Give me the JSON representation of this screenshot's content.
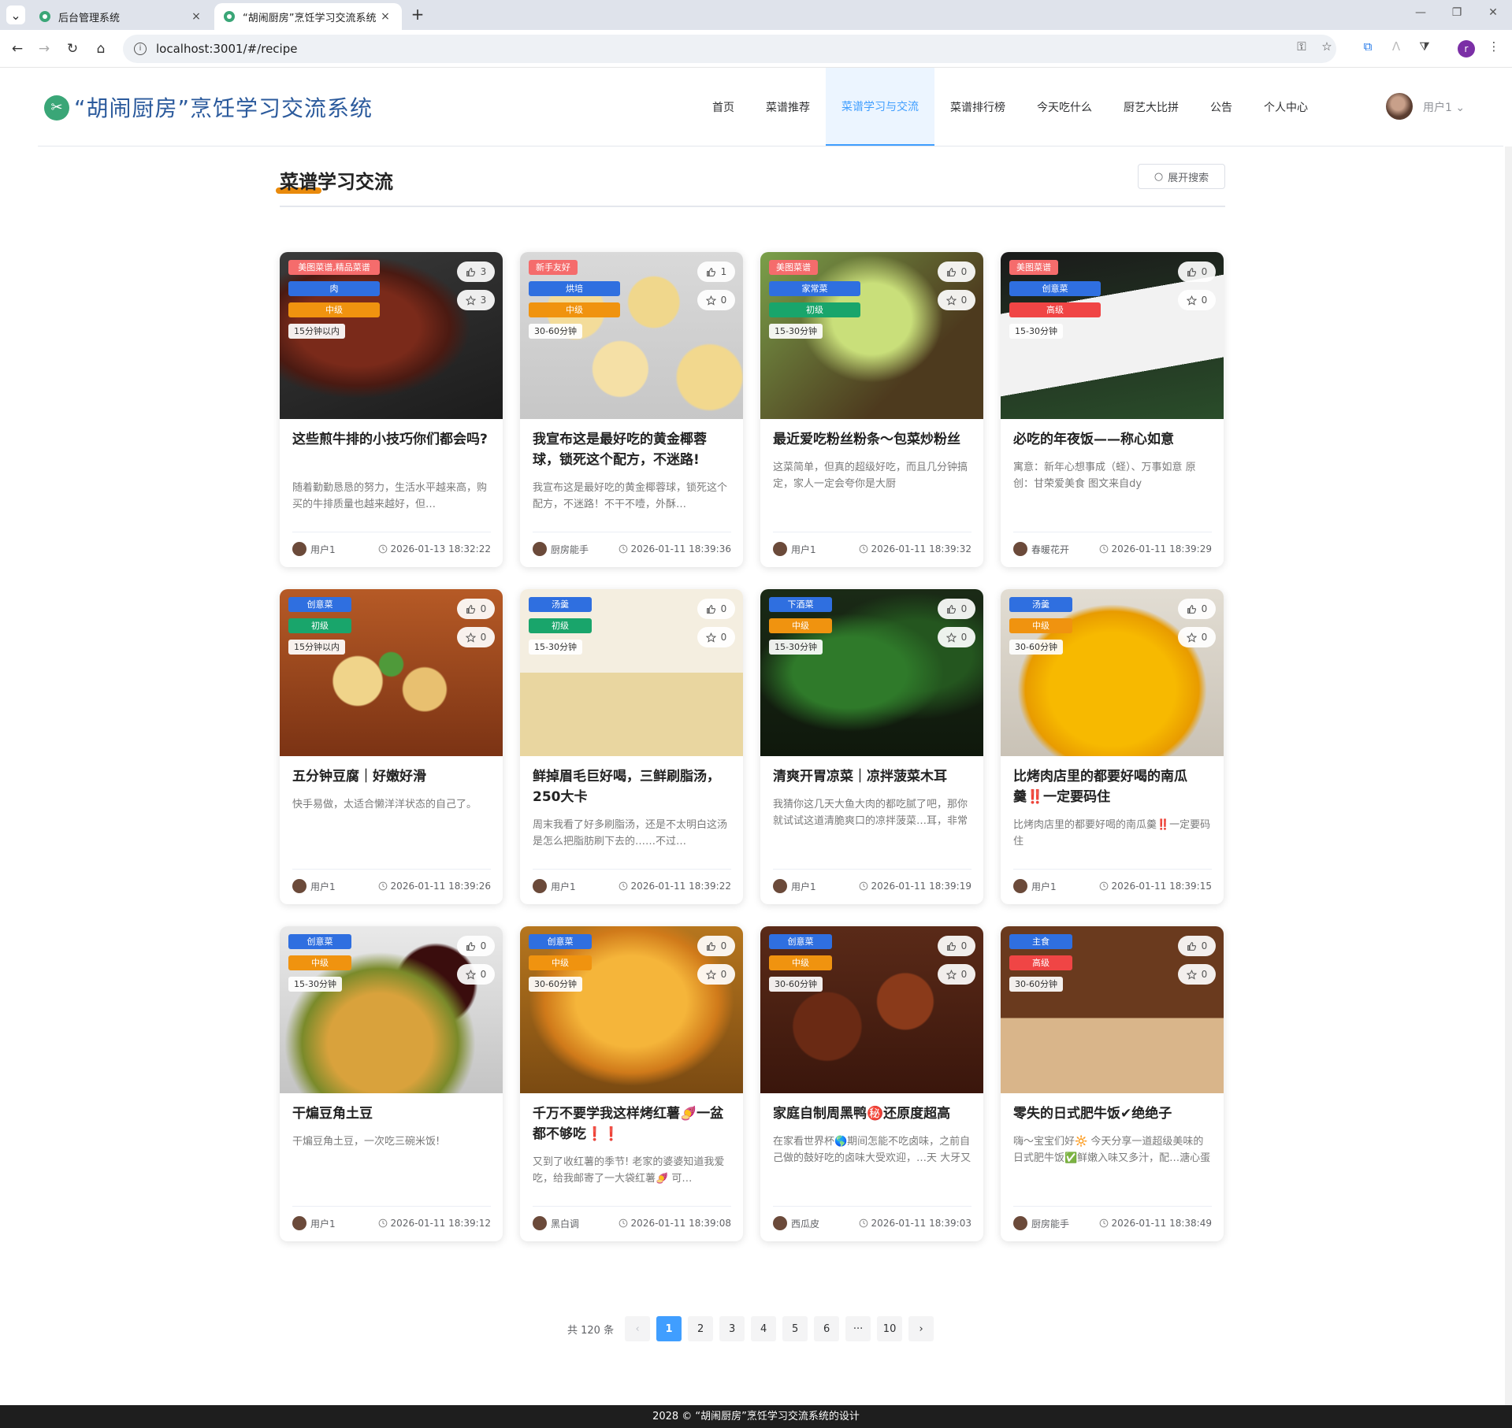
{
  "browser": {
    "tabs": [
      {
        "title": "后台管理系统",
        "close": "×"
      },
      {
        "title": "“胡闹厨房”烹饪学习交流系统",
        "close": "×"
      }
    ],
    "new_tab": "+",
    "url": "localhost:3001/#/recipe",
    "profile_initial": "r",
    "icons": {
      "back": "←",
      "forward": "→",
      "reload": "↻",
      "home": "⌂",
      "key": "⚿",
      "star": "☆",
      "ext": "⧉",
      "puzzle": "⧩",
      "menu": "⋮",
      "minimize": "—",
      "restore": "❐",
      "close": "✕",
      "tab_menu": "⌄"
    }
  },
  "header": {
    "site_title": "“胡闹厨房”烹饪学习交流系统",
    "menu": [
      "首页",
      "菜谱推荐",
      "菜谱学习与交流",
      "菜谱排行榜",
      "今天吃什么",
      "厨艺大比拼",
      "公告",
      "个人中心"
    ],
    "active_menu": 2,
    "user_name": "用户1",
    "user_caret": "⌄"
  },
  "section": {
    "title": "菜谱学习交流",
    "search_button": "展开搜索",
    "search_icon": "○"
  },
  "recipes": [
    {
      "tags": [
        {
          "text": "美图菜谱,精品菜谱",
          "color": "#f56c6c"
        },
        {
          "text": "肉",
          "color": "#2f6fe0"
        },
        {
          "text": "中级",
          "color": "#f0930f"
        },
        {
          "text": "15分钟以内",
          "color": "time"
        }
      ],
      "likes": "3",
      "favs": "3",
      "title": "这些煎牛排的小技巧你们都会吗?",
      "desc": "随着勤勤恳恳的努力，生活水平越来高，购买的牛排质量也越来越好，但…",
      "author": "用户1",
      "date": "2026-01-13 18:32:22",
      "img": "steak"
    },
    {
      "tags": [
        {
          "text": "新手友好",
          "color": "#f56c6c"
        },
        {
          "text": "烘培",
          "color": "#2f6fe0"
        },
        {
          "text": "中级",
          "color": "#f0930f"
        },
        {
          "text": "30-60分钟",
          "color": "time"
        }
      ],
      "likes": "1",
      "favs": "0",
      "title": "我宣布这是最好吃的黄金椰蓉球，锁死这个配方，不迷路!",
      "desc": "我宣布这是最好吃的黄金椰蓉球，锁死这个配方，不迷路！不干不噎，外酥…",
      "author": "厨房能手",
      "date": "2026-01-11 18:39:36",
      "img": "coconut"
    },
    {
      "tags": [
        {
          "text": "美图菜谱",
          "color": "#f56c6c"
        },
        {
          "text": "家常菜",
          "color": "#2f6fe0"
        },
        {
          "text": "初级",
          "color": "#19a56b"
        },
        {
          "text": "15-30分钟",
          "color": "time"
        }
      ],
      "likes": "0",
      "favs": "0",
      "title": "最近爱吃粉丝粉条～包菜炒粉丝",
      "desc": "这菜简单，但真的超级好吃，而且几分钟搞定，家人一定会夸你是大厨",
      "author": "用户1",
      "date": "2026-01-11 18:39:32",
      "img": "cabbage"
    },
    {
      "tags": [
        {
          "text": "美图菜谱",
          "color": "#f56c6c"
        },
        {
          "text": "创意菜",
          "color": "#2f6fe0"
        },
        {
          "text": "高级",
          "color": "#f04545"
        },
        {
          "text": "15-30分钟",
          "color": "time"
        }
      ],
      "likes": "0",
      "favs": "0",
      "title": "必吃的年夜饭——称心如意",
      "desc": "寓意：新年心想事成（蛏）、万事如意 原创：甘荣爱美食 图文来自dy",
      "author": "春暖花开",
      "date": "2026-01-11 18:39:29",
      "img": "razor"
    },
    {
      "tags": [
        {
          "text": "创意菜",
          "color": "#2f6fe0"
        },
        {
          "text": "初级",
          "color": "#19a56b"
        },
        {
          "text": "15分钟以内",
          "color": "time"
        }
      ],
      "likes": "0",
      "favs": "0",
      "title": "五分钟豆腐｜好嫩好滑",
      "desc": "快手易做，太适合懒洋洋状态的自己了。",
      "author": "用户1",
      "date": "2026-01-11 18:39:26",
      "img": "tofu"
    },
    {
      "tags": [
        {
          "text": "汤羹",
          "color": "#2f6fe0"
        },
        {
          "text": "初级",
          "color": "#19a56b"
        },
        {
          "text": "15-30分钟",
          "color": "time"
        }
      ],
      "likes": "0",
      "favs": "0",
      "title": "鲜掉眉毛巨好喝，三鲜刷脂汤，250大卡",
      "desc": "周末我看了好多刷脂汤，还是不太明白这汤是怎么把脂肪刷下去的……不过…",
      "author": "用户1",
      "date": "2026-01-11 18:39:22",
      "img": "soup"
    },
    {
      "tags": [
        {
          "text": "下酒菜",
          "color": "#2f6fe0"
        },
        {
          "text": "中级",
          "color": "#f0930f"
        },
        {
          "text": "15-30分钟",
          "color": "time"
        }
      ],
      "likes": "0",
      "favs": "0",
      "title": "清爽开胃凉菜｜凉拌菠菜木耳",
      "desc": "我猜你这几天大鱼大肉的都吃腻了吧，那你就试试这道清脆爽口的凉拌菠菜…耳，非常解腻！",
      "author": "用户1",
      "date": "2026-01-11 18:39:19",
      "img": "spinach"
    },
    {
      "tags": [
        {
          "text": "汤羹",
          "color": "#2f6fe0"
        },
        {
          "text": "中级",
          "color": "#f0930f"
        },
        {
          "text": "30-60分钟",
          "color": "time"
        }
      ],
      "likes": "0",
      "favs": "0",
      "title": "比烤肉店里的都要好喝的南瓜羹‼️一定要码住",
      "desc": "比烤肉店里的都要好喝的南瓜羹‼️一定要码住",
      "author": "用户1",
      "date": "2026-01-11 18:39:15",
      "img": "pumpkin"
    },
    {
      "tags": [
        {
          "text": "创意菜",
          "color": "#2f6fe0"
        },
        {
          "text": "中级",
          "color": "#f0930f"
        },
        {
          "text": "15-30分钟",
          "color": "time"
        }
      ],
      "likes": "0",
      "favs": "0",
      "title": "干煸豆角土豆",
      "desc": "干煸豆角土豆，一次吃三碗米饭!",
      "author": "用户1",
      "date": "2026-01-11 18:39:12",
      "img": "beans"
    },
    {
      "tags": [
        {
          "text": "创意菜",
          "color": "#2f6fe0"
        },
        {
          "text": "中级",
          "color": "#f0930f"
        },
        {
          "text": "30-60分钟",
          "color": "time"
        }
      ],
      "likes": "0",
      "favs": "0",
      "title": "千万不要学我这样烤红薯🍠一盆都不够吃❗️❗️",
      "desc": "又到了收红薯的季节! 老家的婆婆知道我爱吃，给我邮寄了一大袋红薯🍠 可…",
      "author": "黑白调",
      "date": "2026-01-11 18:39:08",
      "img": "potato"
    },
    {
      "tags": [
        {
          "text": "创意菜",
          "color": "#2f6fe0"
        },
        {
          "text": "中级",
          "color": "#f0930f"
        },
        {
          "text": "30-60分钟",
          "color": "time"
        }
      ],
      "likes": "0",
      "favs": "0",
      "title": "家庭自制周黑鸭㊙️还原度超高",
      "desc": "在家看世界杯🌎期间怎能不吃卤味，之前自己做的鼓好吃的卤味大受欢迎，…天 大牙又成功复 刻了周黑鸭🦆这味道真",
      "author": "西瓜皮",
      "date": "2026-01-11 18:39:03",
      "img": "duck"
    },
    {
      "tags": [
        {
          "text": "主食",
          "color": "#2f6fe0"
        },
        {
          "text": "高级",
          "color": "#f04545"
        },
        {
          "text": "30-60分钟",
          "color": "time"
        }
      ],
      "likes": "0",
      "favs": "0",
      "title": "零失的日式肥牛饭✔绝绝子",
      "desc": "嗨～宝宝们好🔆 今天分享一道超级美味的日式肥牛饭✅鲜嫩入味又多汁，配…溏心蛋拌饭真的绝了，一口下去满满的",
      "author": "厨房能手",
      "date": "2026-01-11 18:38:49",
      "img": "beefrice"
    }
  ],
  "pagination": {
    "total": "共 120 条",
    "prev": "‹",
    "next": "›",
    "pages": [
      "1",
      "2",
      "3",
      "4",
      "5",
      "6",
      "···",
      "10"
    ],
    "current": "1"
  },
  "footer": "2028 © “胡闹厨房”烹饪学习交流系统的设计"
}
